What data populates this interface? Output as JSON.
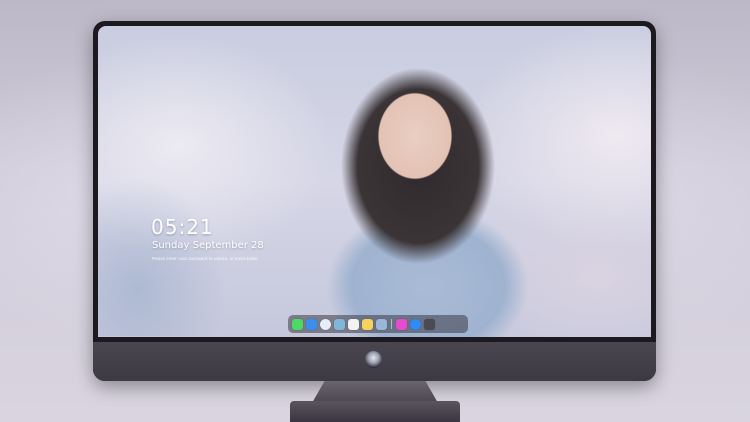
{
  "lock_screen": {
    "time": "05:21",
    "date": "Sunday September  28",
    "subtext": "Please enter your password to unlock, or press Enter"
  },
  "dock": {
    "apps": [
      {
        "name": "messages-icon",
        "color": "#4cd964"
      },
      {
        "name": "finder-icon",
        "color": "#3a8ef0"
      },
      {
        "name": "safari-icon",
        "color": "#e8eef8"
      },
      {
        "name": "photos-icon",
        "color": "#7fb6d9"
      },
      {
        "name": "clapper-icon",
        "color": "#f2f2f2"
      },
      {
        "name": "notes-icon",
        "color": "#f8d25b"
      },
      {
        "name": "preview-icon",
        "color": "#9ab7d8"
      },
      {
        "name": "music-icon",
        "color": "#e94bd0"
      },
      {
        "name": "appstore-icon",
        "color": "#2f8cf7"
      },
      {
        "name": "camera-icon",
        "color": "#4a4a52"
      }
    ]
  },
  "colors": {
    "monitor_bezel": "#1c1a1f",
    "monitor_chin": "#45414b",
    "dock_bg": "#3c3a46"
  }
}
